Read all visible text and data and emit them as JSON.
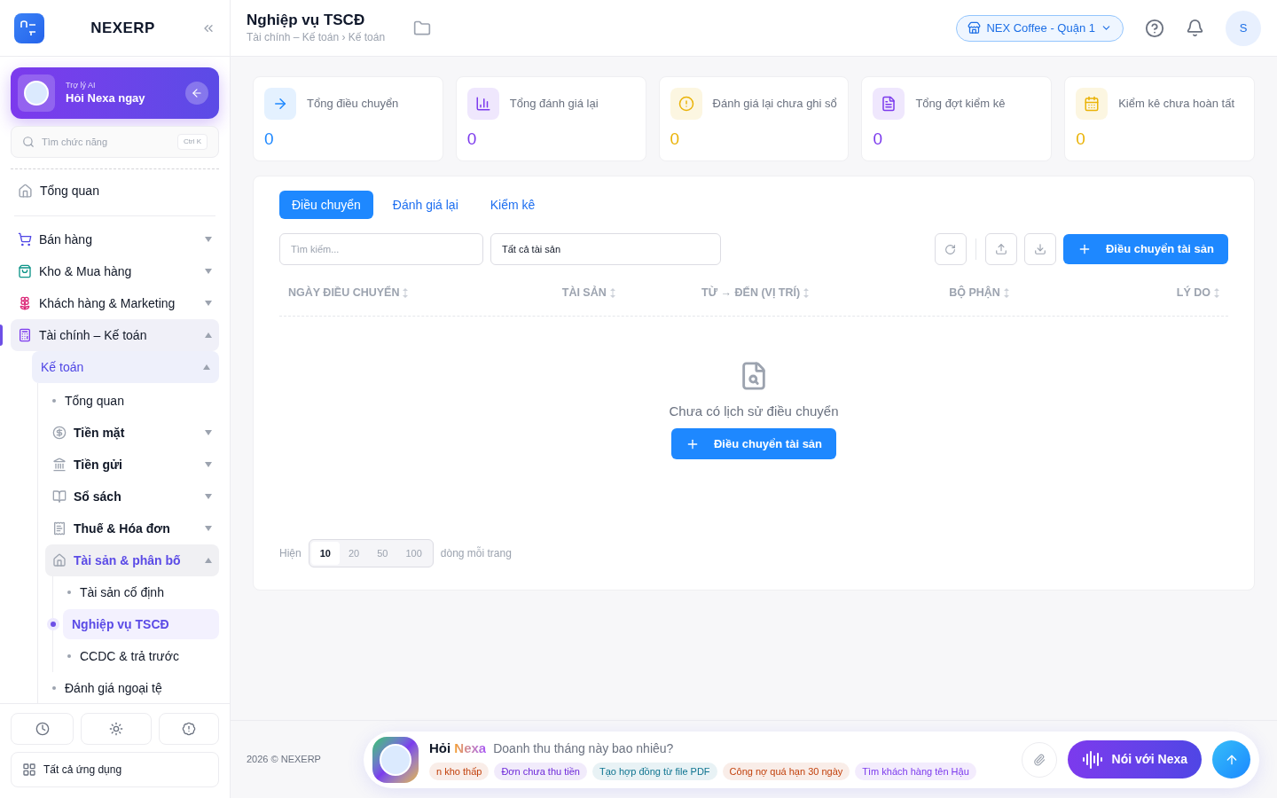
{
  "sidebar": {
    "brand": "NEXERP",
    "ai_card": {
      "caption": "Trợ lý AI",
      "title": "Hỏi Nexa ngay"
    },
    "search": {
      "placeholder": "Tìm chức năng",
      "shortcut": "Ctrl K"
    },
    "overview": {
      "label": "Tổng quan",
      "selected": false
    },
    "groups": [
      {
        "label": "Bán hàng",
        "expanded": false,
        "selected": false
      },
      {
        "label": "Kho & Mua hàng",
        "expanded": false,
        "selected": false
      },
      {
        "label": "Khách hàng & Marketing",
        "expanded": false,
        "selected": false
      },
      {
        "label": "Tài chính – Kế toán",
        "expanded": true,
        "selected": true,
        "children": [
          {
            "label": "Kế toán",
            "expanded": true,
            "selected": true,
            "children": [
              {
                "label": "Tổng quan",
                "kind": "link",
                "selected": false
              },
              {
                "label": "Tiền mặt",
                "kind": "group",
                "expanded": false,
                "selected": false
              },
              {
                "label": "Tiền gửi",
                "kind": "group",
                "expanded": false,
                "selected": false
              },
              {
                "label": "Sổ sách",
                "kind": "group",
                "expanded": false,
                "selected": false
              },
              {
                "label": "Thuế & Hóa đơn",
                "kind": "group",
                "expanded": false,
                "selected": false
              },
              {
                "label": "Tài sản & phân bố",
                "kind": "group",
                "expanded": true,
                "selected": true,
                "children": [
                  {
                    "label": "Tài sản cố định",
                    "selected": false
                  },
                  {
                    "label": "Nghiệp vụ TSCĐ",
                    "selected": true
                  },
                  {
                    "label": "CCDC & trả trước",
                    "selected": false
                  }
                ]
              },
              {
                "label": "Đánh giá ngoại tệ",
                "kind": "link",
                "selected": false
              }
            ]
          }
        ]
      }
    ],
    "all_apps": "Tất cả ứng dụng"
  },
  "header": {
    "title": "Nghiệp vụ TSCĐ",
    "breadcrumb": "Tài chính – Kế toán › Kế toán",
    "store": "NEX Coffee - Quận 1",
    "avatar": "S"
  },
  "stats": [
    {
      "label": "Tổng điều chuyển",
      "value": "0",
      "color": "#1e88ff"
    },
    {
      "label": "Tổng đánh giá lại",
      "value": "0",
      "color": "#7c3aed"
    },
    {
      "label": "Đánh giá lại chưa ghi sổ",
      "value": "0",
      "color": "#eab308"
    },
    {
      "label": "Tổng đợt kiểm kê",
      "value": "0",
      "color": "#7c3aed"
    },
    {
      "label": "Kiểm kê chưa hoàn tất",
      "value": "0",
      "color": "#eab308"
    }
  ],
  "tabs": [
    {
      "label": "Điều chuyển",
      "selected": true
    },
    {
      "label": "Đánh giá lại",
      "selected": false
    },
    {
      "label": "Kiểm kê",
      "selected": false
    }
  ],
  "filters": {
    "search_placeholder": "Tìm kiếm...",
    "asset_filter": "Tất cả tài sản",
    "primary_action": "Điều chuyển tài sản"
  },
  "table": {
    "columns": [
      "NGÀY ĐIỀU CHUYỂN",
      "TÀI SẢN",
      "TỪ → ĐẾN (VỊ TRÍ)",
      "BỘ PHẬN",
      "LÝ DO"
    ],
    "empty": {
      "message": "Chưa có lịch sử điều chuyển",
      "action": "Điều chuyển tài sản"
    }
  },
  "pagination": {
    "prefix": "Hiện",
    "suffix": "dòng mỗi trang",
    "sizes": [
      {
        "label": "10",
        "selected": true
      },
      {
        "label": "20",
        "selected": false
      },
      {
        "label": "50",
        "selected": false
      },
      {
        "label": "100",
        "selected": false
      }
    ]
  },
  "footer": {
    "copyright": "2026 © NEXERP"
  },
  "assistant": {
    "ask": "Hỏi",
    "name": "Nexa",
    "prompt": "Doanh thu tháng này bao nhiêu?",
    "voice_button": "Nói với Nexa",
    "suggestions": [
      {
        "label": "n kho thấp",
        "color": "#c2410c"
      },
      {
        "label": "Đơn chưa thu tiền",
        "color": "#6d28d9"
      },
      {
        "label": "Tạo hợp đồng từ file PDF",
        "color": "#0e7490"
      },
      {
        "label": "Công nợ quá hạn 30 ngày",
        "color": "#c2410c"
      },
      {
        "label": "Tìm khách hàng tên Hậu",
        "color": "#7c3aed"
      }
    ]
  }
}
